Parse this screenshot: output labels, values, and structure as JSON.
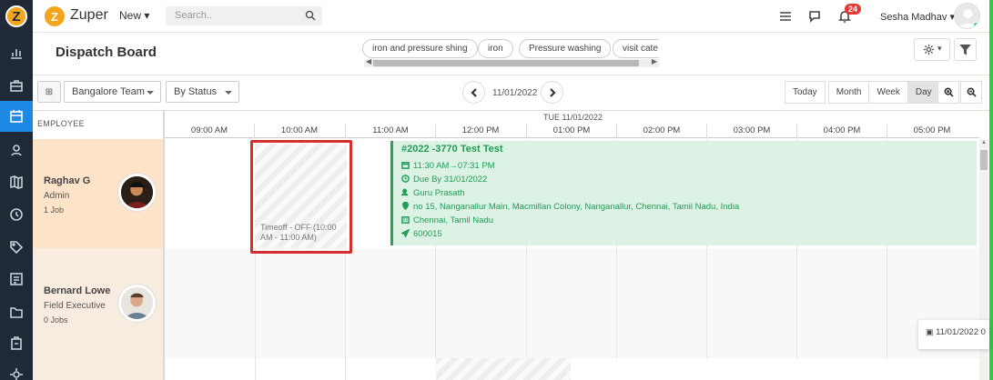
{
  "app": {
    "brand": "Zuper",
    "new_label": "New",
    "search_placeholder": "Search..",
    "notification_count": "24",
    "user_name": "Sesha Madhav"
  },
  "rail": {
    "icons": [
      "logo-icon",
      "analytics-icon",
      "briefcase-icon",
      "calendar-icon",
      "contacts-icon",
      "map-icon",
      "clock-icon",
      "tag-icon",
      "invoice-icon",
      "folder-icon",
      "assets-icon",
      "settings-icon"
    ]
  },
  "board": {
    "title": "Dispatch Board",
    "chips": [
      "iron and pressure shing",
      "iron",
      "Pressure washing",
      "visit cate"
    ],
    "team_select": "Bangalore Team",
    "status_select": "By Status",
    "current_date": "11/01/2022",
    "views": [
      "Today",
      "Month",
      "Week",
      "Day"
    ],
    "active_view": "Day"
  },
  "grid": {
    "employee_header": "EMPLOYEE",
    "day_header": "TUE 11/01/2022",
    "times": [
      "09:00 AM",
      "10:00 AM",
      "11:00 AM",
      "12:00 PM",
      "01:00 PM",
      "02:00 PM",
      "03:00 PM",
      "04:00 PM",
      "05:00 PM"
    ]
  },
  "employees": [
    {
      "name": "Raghav G",
      "role": "Admin",
      "jobs": "1 Job"
    },
    {
      "name": "Bernard Lowe",
      "role": "Field Executive",
      "jobs": "0 Jobs"
    }
  ],
  "timeoff": {
    "label": "Timeoff - OFF (10:00 AM - 11:00 AM)"
  },
  "job": {
    "title": "#2022 -3770 Test Test",
    "time": "11:30 AM→07:31 PM",
    "due": "Due By 31/01/2022",
    "assignee": "Guru Prasath",
    "address": "no 15, Nanganallur Main, Macmillan Colony, Nanganallur, Chennai, Tamil Nadu, India",
    "city": "Chennai, Tamil Nadu",
    "pincode": "600015"
  },
  "tooltip": {
    "date": "11/01/2022 0"
  },
  "colors": {
    "rail": "#1f2a36",
    "accent": "#1e88e5",
    "brand": "#f3a51e",
    "job_bg": "#dcf2e4",
    "job_text": "#1f9d55",
    "highlight": "#d32f2f",
    "row1": "#fde3c7",
    "row2": "#f8ece0"
  }
}
